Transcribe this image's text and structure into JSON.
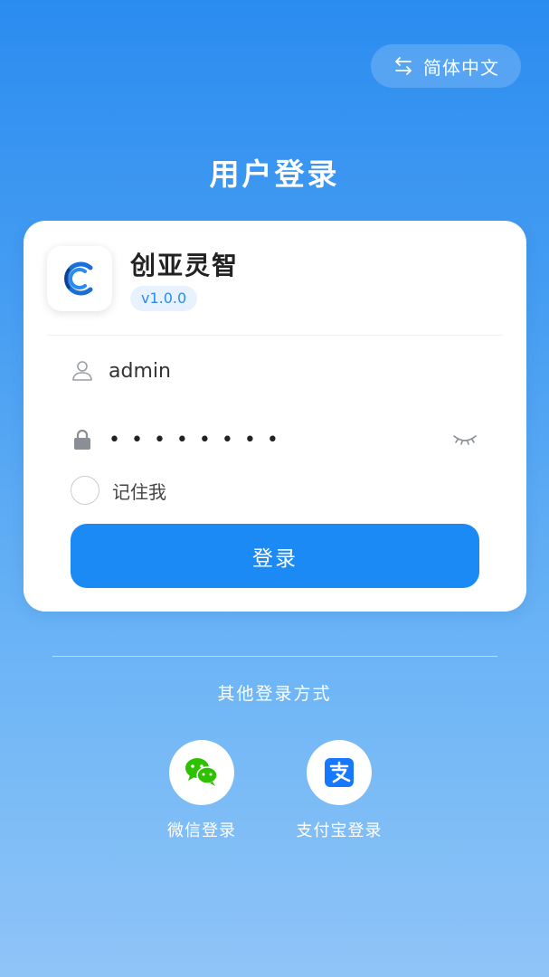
{
  "language_switch": {
    "label": "简体中文",
    "icon": "swap-arrows-icon"
  },
  "page_title": "用户登录",
  "app": {
    "name": "创亚灵智",
    "version": "v1.0.0",
    "logo": "app-logo-icon"
  },
  "form": {
    "username": {
      "value": "admin",
      "icon": "user-icon"
    },
    "password": {
      "masked_value": "••••••••",
      "icon": "lock-icon",
      "toggle_icon": "eye-closed-icon"
    },
    "remember_me": {
      "label": "记住我",
      "checked": false
    },
    "submit_label": "登录"
  },
  "other_login": {
    "title": "其他登录方式",
    "options": [
      {
        "label": "微信登录",
        "icon": "wechat-icon"
      },
      {
        "label": "支付宝登录",
        "icon": "alipay-icon"
      }
    ]
  },
  "colors": {
    "primary": "#1c8af5",
    "wechat": "#2dc100",
    "alipay": "#1677ff"
  }
}
